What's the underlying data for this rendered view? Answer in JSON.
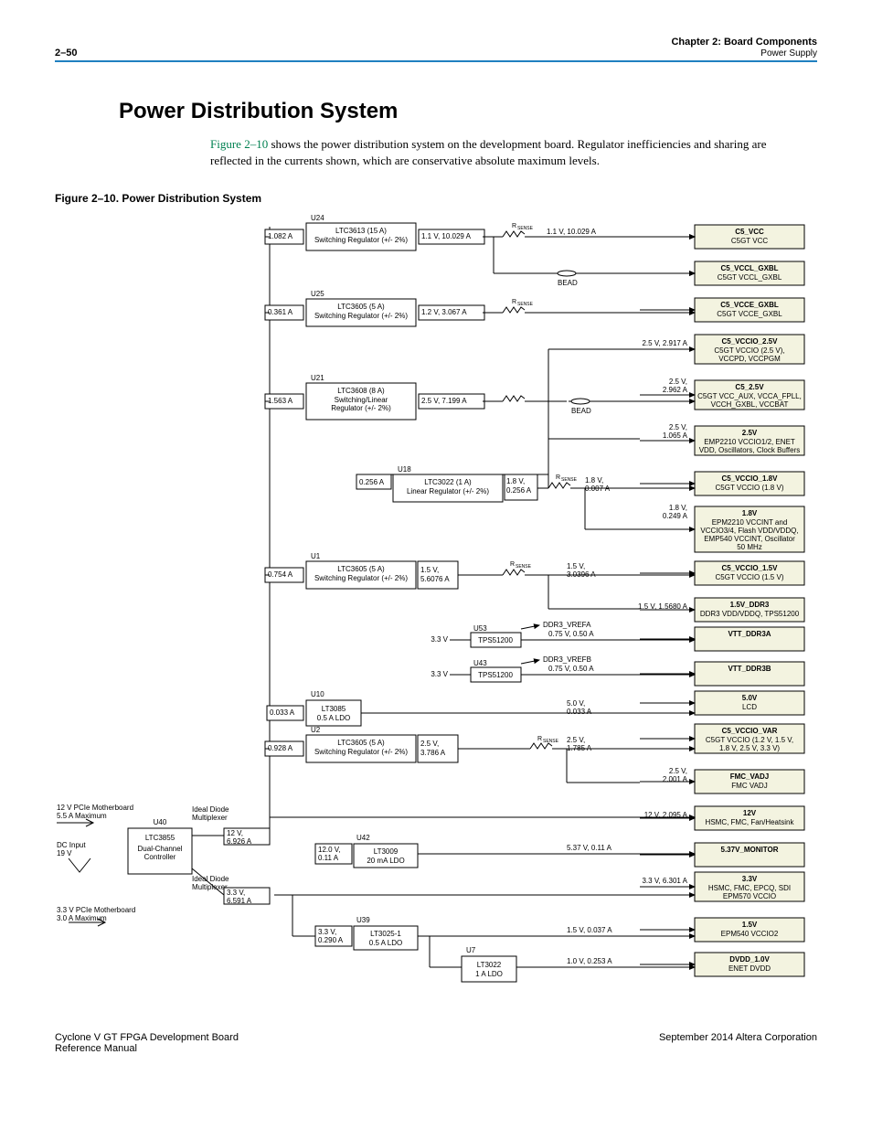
{
  "header": {
    "pageNum": "2–50",
    "chapter": "Chapter 2: Board Components",
    "section": "Power Supply"
  },
  "title": "Power Distribution System",
  "intro": {
    "linkText": "Figure 2–10",
    "rest": " shows the power distribution system on the development board. Regulator inefficiencies and sharing are reflected in the currents shown, which are conservative absolute maximum levels."
  },
  "figCaption": "Figure 2–10.  Power Distribution System",
  "inputs": {
    "pcie12": "12 V PCIe Motherboard\n5.5 A Maximum",
    "dcin": "DC Input\n19 V",
    "pcie33": "3.3 V PCIe Motherboard\n3.0 A Maximum"
  },
  "controller": {
    "ref": "U40",
    "name": "LTC3855",
    "sub": "Dual-Channel\nController",
    "diode": "Ideal Diode\nMultiplexer"
  },
  "bus12": "12 V,\n6.926 A",
  "bus33": "3.3 V,\n6.591 A",
  "rsense": "RSENSE",
  "bead": "BEAD",
  "regs": {
    "u24": {
      "ref": "U24",
      "name": "LTC3613 (15 A)",
      "sub": "Switching Regulator (+/- 2%)",
      "in": "1.082 A",
      "out": "1.1 V, 10.029 A",
      "send": "1.1 V, 10.029 A"
    },
    "u25": {
      "ref": "U25",
      "name": "LTC3605 (5 A)",
      "sub": "Switching Regulator (+/- 2%)",
      "in": "0.361 A",
      "out": "1.2 V, 3.067 A"
    },
    "u21": {
      "ref": "U21",
      "name": "LTC3608 (8 A)",
      "sub": "Switching/Linear\nRegulator (+/- 2%)",
      "in": "1.563 A",
      "out": "2.5 V, 7.199 A"
    },
    "u18": {
      "ref": "U18",
      "name": "LTC3022 (1 A)",
      "sub": "Linear Regulator (+/- 2%)",
      "in": "0.256 A",
      "outV": "1.8 V,",
      "outA": "0.256 A",
      "send": "1.8 V,\n0.007 A"
    },
    "u1": {
      "ref": "U1",
      "name": "LTC3605 (5 A)",
      "sub": "Switching Regulator (+/- 2%)",
      "in": "0.754 A",
      "outV": "1.5 V,",
      "outA": "5.6076 A",
      "send": "1.5 V,\n3.0396 A"
    },
    "u10": {
      "ref": "U10",
      "name": "LT3085",
      "sub": "0.5 A LDO",
      "in": "0.033 A",
      "out": "5.0 V,\n0.033 A"
    },
    "u2": {
      "ref": "U2",
      "name": "LTC3605 (5 A)",
      "sub": "Switching Regulator (+/- 2%)",
      "in": "0.928 A",
      "outV": "2.5 V,",
      "outA": "3.786 A",
      "send": "2.5 V,\n1.785 A"
    },
    "u42": {
      "ref": "U42",
      "name": "LT3009",
      "sub": "20 mA LDO",
      "in": "12.0 V,\n0.11 A",
      "out": "5.37 V, 0.11 A"
    },
    "u39": {
      "ref": "U39",
      "name": "LT3025-1",
      "sub": "0.5 A LDO",
      "in": "3.3 V,\n0.290 A",
      "out": "1.5 V, 0.037 A"
    },
    "u7": {
      "ref": "U7",
      "name": "LT3022",
      "sub": "1 A LDO",
      "out": "1.0 V, 0.253 A"
    },
    "u53": {
      "ref": "U53",
      "name": "TPS51200",
      "in": "3.3 V",
      "out": "0.75 V, 0.50 A",
      "label": "DDR3_VREFA"
    },
    "u43": {
      "ref": "U43",
      "name": "TPS51200",
      "in": "3.3 V",
      "out": "0.75 V, 0.50 A",
      "label": "DDR3_VREFB"
    }
  },
  "rails": [
    {
      "t": "C5_VCC",
      "s": "C5GT VCC"
    },
    {
      "t": "C5_VCCL_GXBL",
      "s": "C5GT VCCL_GXBL"
    },
    {
      "t": "C5_VCCE_GXBL",
      "s": "C5GT VCCE_GXBL"
    },
    {
      "t": "C5_VCCIO_2.5V",
      "s": "C5GT VCCIO (2.5 V),\nVCCPD, VCCPGM",
      "pre": "2.5 V, 2.917 A"
    },
    {
      "t": "C5_2.5V",
      "s": "C5GT VCC_AUX, VCCA_FPLL,\nVCCH_GXBL, VCCBAT",
      "pre": "2.5 V,\n2.962 A"
    },
    {
      "t": "2.5V",
      "s": "EMP2210 VCCIO1/2, ENET\nVDD, Oscillators, Clock Buffers",
      "pre": "2.5 V,\n1.065 A"
    },
    {
      "t": "C5_VCCIO_1.8V",
      "s": "C5GT VCCIO (1.8 V)"
    },
    {
      "t": "1.8V",
      "s": "EPM2210 VCCINT and\nVCCIO3/4, Flash VDD/VDDQ,\nEMP540 VCCINT, Oscillator\n50 MHz",
      "pre": "1.8 V,\n0.249 A"
    },
    {
      "t": "C5_VCCIO_1.5V",
      "s": "C5GT VCCIO (1.5 V)"
    },
    {
      "t": "1.5V_DDR3",
      "s": "DDR3 VDD/VDDQ, TPS51200",
      "pre": "1.5 V, 1.5680 A"
    },
    {
      "t": "VTT_DDR3A",
      "s": ""
    },
    {
      "t": "VTT_DDR3B",
      "s": ""
    },
    {
      "t": "5.0V",
      "s": "LCD"
    },
    {
      "t": "C5_VCCIO_VAR",
      "s": "C5GT VCCIO (1.2 V, 1.5 V,\n1.8 V, 2.5 V, 3.3 V)"
    },
    {
      "t": "FMC_VADJ",
      "s": "FMC VADJ",
      "pre": "2.5 V,\n2.001 A"
    },
    {
      "t": "12V",
      "s": "HSMC, FMC, Fan/Heatsink",
      "pre": "12 V, 2.095 A"
    },
    {
      "t": "5.37V_MONITOR",
      "s": ""
    },
    {
      "t": "3.3V",
      "s": "HSMC, FMC, EPCQ, SDI\nEPM570 VCCIO",
      "pre": "3.3 V, 6.301 A"
    },
    {
      "t": "1.5V",
      "s": "EPM540 VCCIO2"
    },
    {
      "t": "DVDD_1.0V",
      "s": "ENET DVDD"
    }
  ],
  "footer": {
    "l1": "Cyclone V GT FPGA Development Board",
    "l2": "Reference Manual",
    "r": "September 2014   Altera Corporation"
  }
}
